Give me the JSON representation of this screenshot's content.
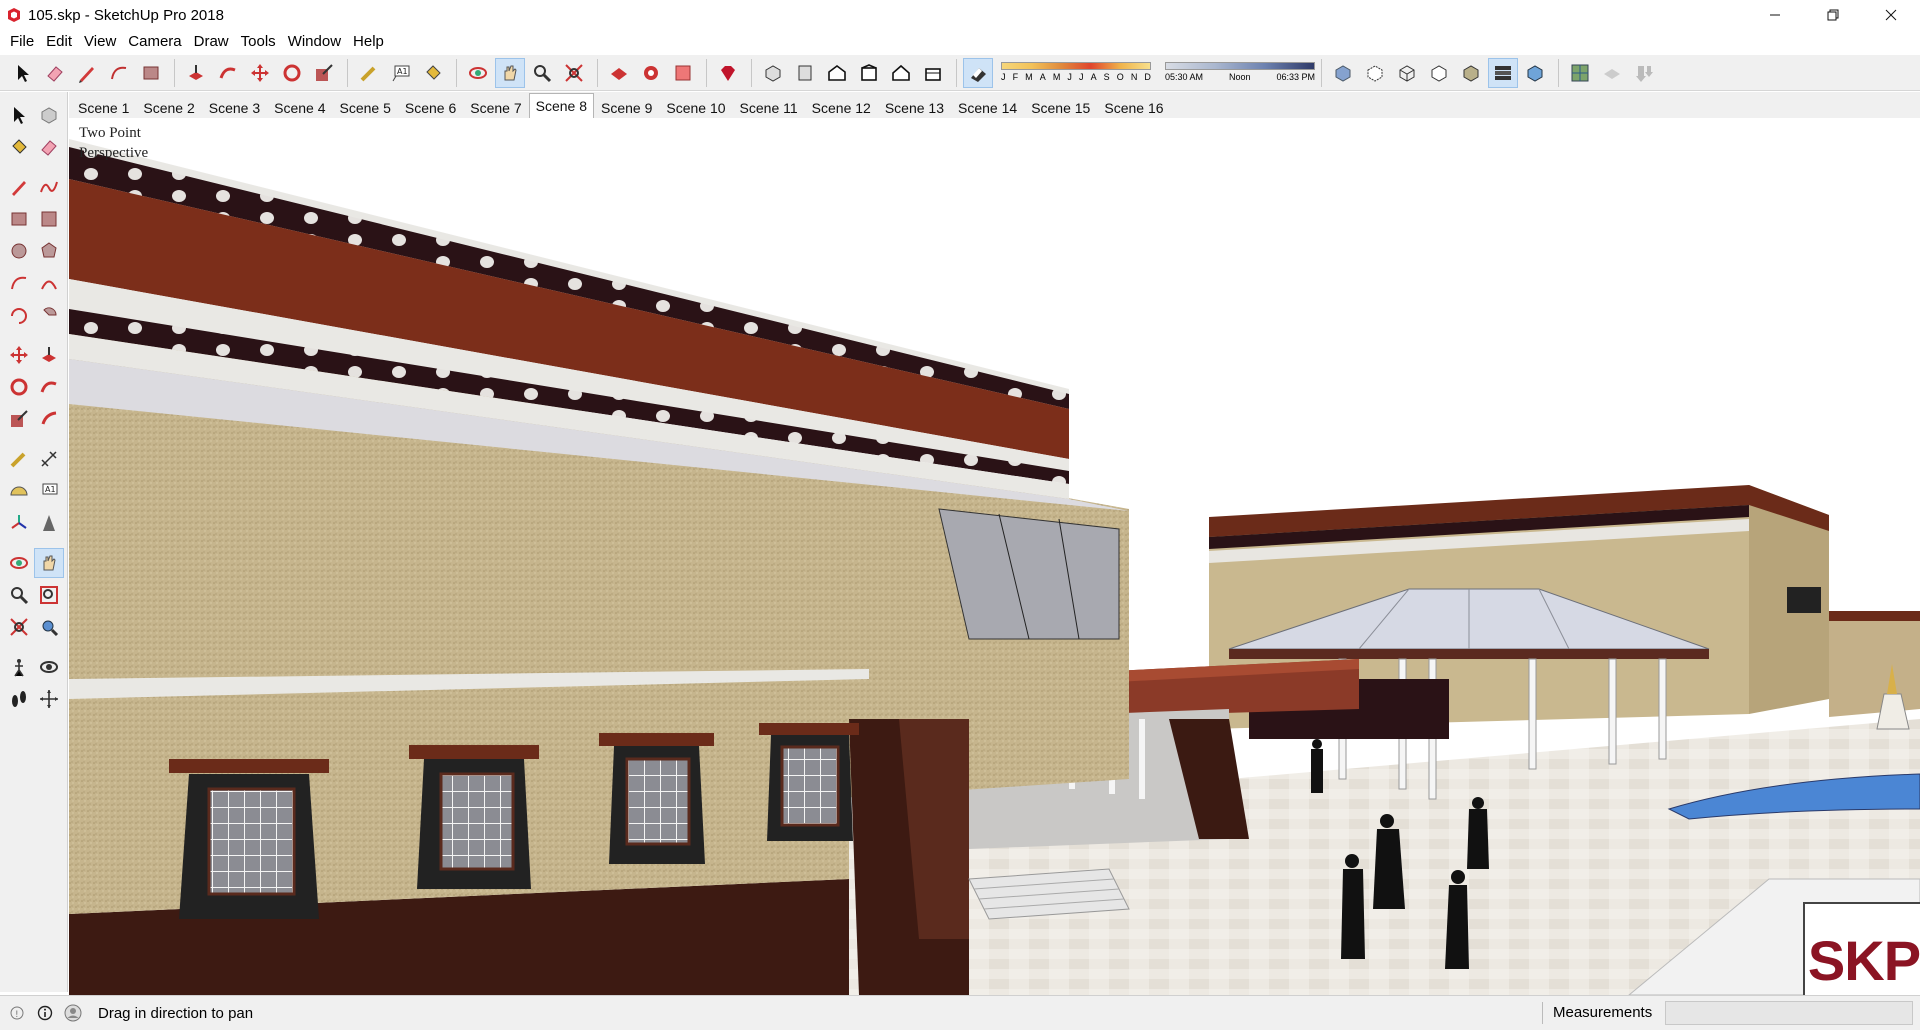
{
  "window": {
    "title": "105.skp - SketchUp Pro 2018",
    "controls": [
      "minimize-icon",
      "restore-icon",
      "close-icon"
    ]
  },
  "menu": [
    "File",
    "Edit",
    "View",
    "Camera",
    "Draw",
    "Tools",
    "Window",
    "Help"
  ],
  "toolbar": {
    "groups": [
      [
        "select-icon",
        "eraser-icon",
        "pencil-icon",
        "arc-icon",
        "rectangle-icon"
      ],
      [
        "push-pull-icon",
        "follow-me-icon",
        "move-icon",
        "rotate-icon",
        "scale-icon"
      ],
      [
        "tape-measure-icon",
        "text-icon",
        "paint-bucket-icon"
      ],
      [
        "orbit-icon",
        "pan-icon",
        "zoom-icon",
        "zoom-extents-icon"
      ],
      [
        "3d-warehouse-icon",
        "extension-warehouse-icon",
        "layout-icon"
      ],
      [
        "ruby-icon"
      ],
      [
        "iso-view-icon",
        "top-view-icon",
        "front-view-icon",
        "right-view-icon",
        "back-view-icon",
        "left-view-icon"
      ],
      [
        "shadows-toggle-icon"
      ]
    ],
    "active": "pan-icon",
    "shadow_months": [
      "J",
      "F",
      "M",
      "A",
      "M",
      "J",
      "J",
      "A",
      "S",
      "O",
      "N",
      "D"
    ],
    "shadow_time": {
      "start": "05:30 AM",
      "mid": "Noon",
      "end": "06:33 PM"
    },
    "style_icons": [
      "xray-icon",
      "back-edges-icon",
      "wireframe-icon",
      "hidden-line-icon",
      "shaded-icon",
      "shaded-textures-icon",
      "monochrome-icon"
    ],
    "extra_icons": [
      "geo-location-icon",
      "add-location-icon",
      "sandbox-icon"
    ]
  },
  "left_toolbar": {
    "rows": [
      [
        "select-icon",
        "make-component-icon"
      ],
      [
        "paint-bucket-icon",
        "eraser-icon"
      ],
      [],
      [
        "line-icon",
        "freehand-icon"
      ],
      [
        "rectangle-icon",
        "rotated-rectangle-icon"
      ],
      [
        "circle-icon",
        "polygon-icon"
      ],
      [
        "arc-icon",
        "two-point-arc-icon"
      ],
      [
        "three-point-arc-icon",
        "pie-icon"
      ],
      [],
      [
        "move-icon",
        "push-pull-icon"
      ],
      [
        "rotate-icon",
        "follow-me-icon"
      ],
      [
        "scale-icon",
        "offset-icon"
      ],
      [],
      [
        "tape-measure-icon",
        "dimension-icon"
      ],
      [
        "protractor-icon",
        "text-icon"
      ],
      [
        "axes-icon",
        "3d-text-icon"
      ],
      [],
      [
        "orbit-icon",
        "pan-icon"
      ],
      [
        "zoom-icon",
        "zoom-window-icon"
      ],
      [
        "zoom-extents-icon",
        "previous-view-icon"
      ],
      [],
      [
        "position-camera-icon",
        "look-around-icon"
      ],
      [
        "walk-icon",
        "section-plane-icon"
      ]
    ],
    "active": "pan-icon"
  },
  "scenes": {
    "tabs": [
      "Scene 1",
      "Scene 2",
      "Scene 3",
      "Scene 4",
      "Scene 5",
      "Scene 6",
      "Scene 7",
      "Scene 8",
      "Scene 9",
      "Scene 10",
      "Scene 11",
      "Scene 12",
      "Scene 13",
      "Scene 14",
      "Scene 15",
      "Scene 16"
    ],
    "active": "Scene 8"
  },
  "viewport": {
    "camera_label_line1": "Two Point",
    "camera_label_line2": "Perspective",
    "badge_text": "SKP"
  },
  "status": {
    "message": "Drag in direction to pan",
    "measurements_label": "Measurements",
    "measurements_value": ""
  },
  "colors": {
    "accent_active": "#cfe3f7",
    "badge_red": "#8b1423",
    "building_wall": "#c4b38a",
    "building_trim": "#7a2e1c"
  }
}
